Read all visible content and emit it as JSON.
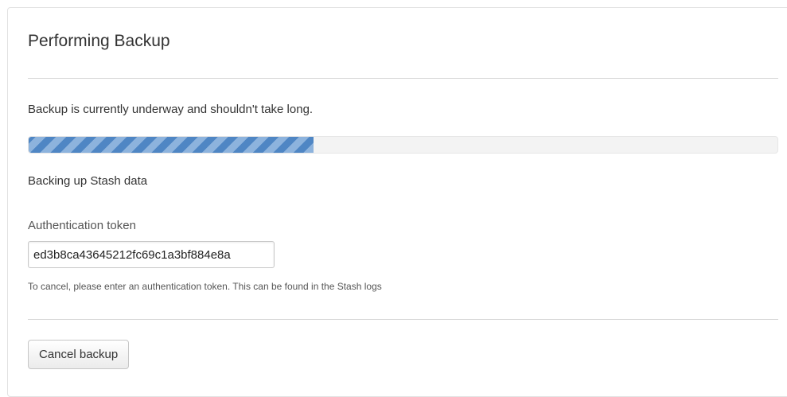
{
  "page": {
    "title": "Performing Backup",
    "message": "Backup is currently underway and shouldn't take long.",
    "status": "Backing up Stash data"
  },
  "progress": {
    "fraction": 0.38,
    "fill_color": "#4f86c4",
    "stripe_color": "#8db3dd"
  },
  "token": {
    "label": "Authentication token",
    "value": "ed3b8ca43645212fc69c1a3bf884e8a",
    "help": "To cancel, please enter an authentication token. This can be found in the Stash logs"
  },
  "actions": {
    "cancel_label": "Cancel backup"
  }
}
